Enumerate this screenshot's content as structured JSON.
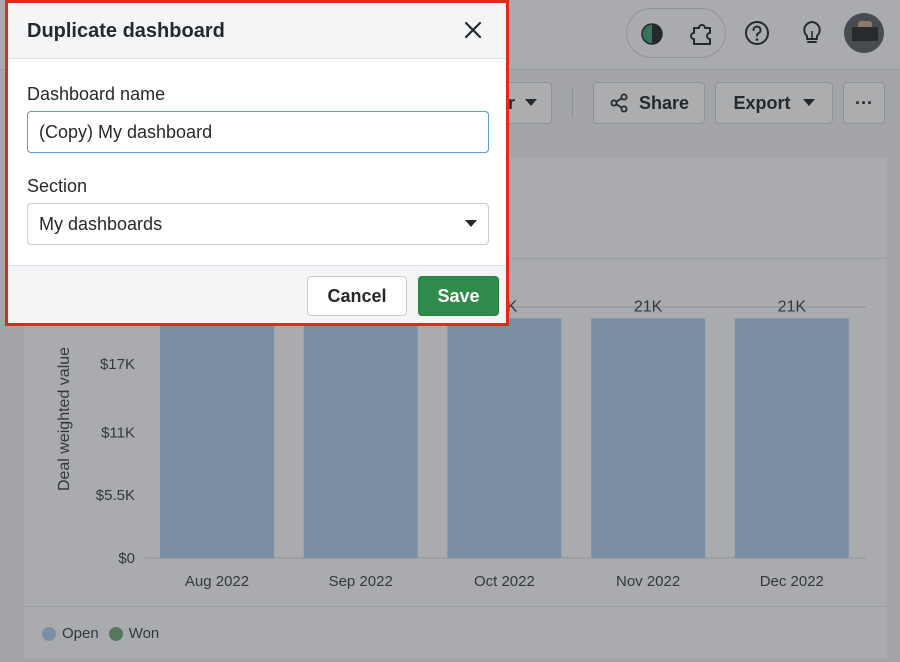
{
  "dialog": {
    "title": "Duplicate dashboard",
    "name_label": "Dashboard name",
    "name_value": "(Copy) My dashboard",
    "section_label": "Section",
    "section_value": "My dashboards",
    "cancel_label": "Cancel",
    "save_label": "Save",
    "close_icon": "close-icon"
  },
  "toolbar": {
    "filter_fragment": "r",
    "share_label": "Share",
    "export_label": "Export",
    "more_label": "···"
  },
  "topbar": {
    "icons": [
      "theme-icon",
      "puzzle-icon",
      "help-icon",
      "lightbulb-icon",
      "avatar"
    ]
  },
  "chart_data": {
    "type": "bar",
    "categories": [
      "Aug 2022",
      "Sep 2022",
      "Oct 2022",
      "Nov 2022",
      "Dec 2022"
    ],
    "series": [
      {
        "name": "Open",
        "values": [
          21000,
          21000,
          21000,
          21000,
          21000
        ],
        "color": "#a9c9e8"
      },
      {
        "name": "Won",
        "values": [
          0,
          0,
          0,
          0,
          0
        ],
        "color": "#6ea37a"
      }
    ],
    "data_labels": [
      "",
      "",
      "K",
      "21K",
      "21K"
    ],
    "ylabel": "Deal weighted value",
    "yticks": [
      "$0",
      "$5.5K",
      "$11K",
      "$17K"
    ],
    "ytick_values": [
      0,
      5500,
      11000,
      17000
    ],
    "ylim": [
      0,
      22000
    ],
    "grid": true,
    "legend": "bottom-left"
  },
  "colors": {
    "accent_save": "#2f8b4b",
    "highlight_border": "#e5281e",
    "bar": "#a9c9e8"
  }
}
